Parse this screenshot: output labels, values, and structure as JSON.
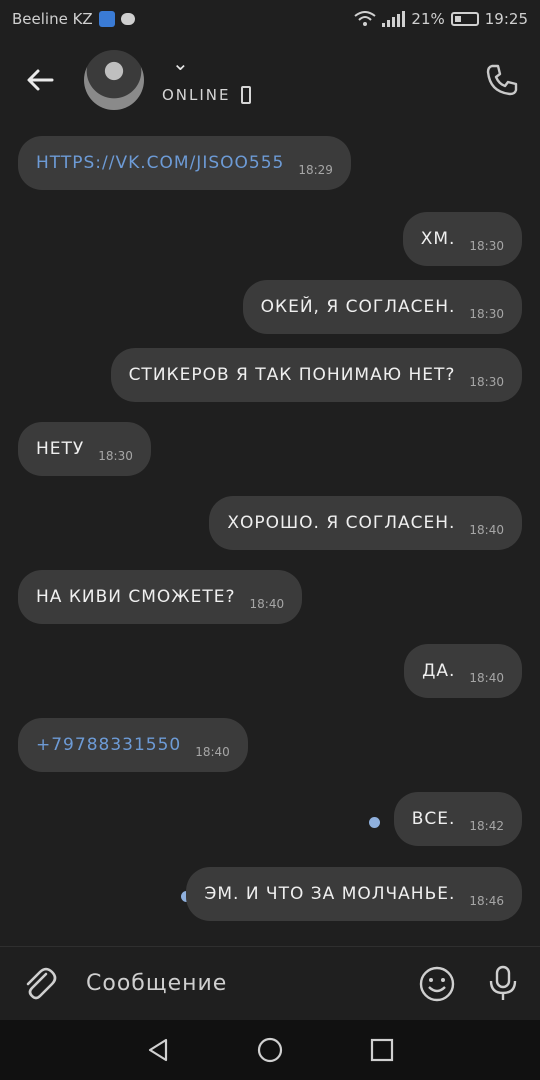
{
  "statusbar": {
    "carrier": "Beeline KZ",
    "battery": "21%",
    "time": "19:25"
  },
  "header": {
    "status": "ONLINE"
  },
  "messages": [
    {
      "dir": "in",
      "text": "https://vk.com/jisoo555",
      "time": "18:29",
      "link": true
    },
    {
      "dir": "out",
      "text": "хм.",
      "time": "18:30"
    },
    {
      "dir": "out",
      "text": "окей, я согласен.",
      "time": "18:30"
    },
    {
      "dir": "out",
      "text": "стикеров я так понимаю нет?",
      "time": "18:30"
    },
    {
      "dir": "in",
      "text": "нету",
      "time": "18:30"
    },
    {
      "dir": "out",
      "text": "хорошо. я согласен.",
      "time": "18:40"
    },
    {
      "dir": "in",
      "text": "на киви сможете?",
      "time": "18:40"
    },
    {
      "dir": "out",
      "text": "да.",
      "time": "18:40"
    },
    {
      "dir": "in",
      "text": "+79788331550",
      "time": "18:40",
      "link": true
    },
    {
      "dir": "out",
      "text": "все.",
      "time": "18:42",
      "unread": true
    },
    {
      "dir": "out",
      "text": "эм. и что за молчанье.",
      "time": "18:46",
      "unread": true
    }
  ],
  "input": {
    "placeholder": "Сообщение"
  },
  "icons": {
    "back": "arrow-left-icon",
    "call": "phone-icon",
    "attach": "paperclip-icon",
    "emoji": "emoji-icon",
    "mic": "microphone-icon"
  },
  "colors": {
    "background": "#1f1f1f",
    "bubble": "#3b3b3b",
    "link": "#6d9bd6",
    "unread_dot": "#8fb0dd"
  }
}
